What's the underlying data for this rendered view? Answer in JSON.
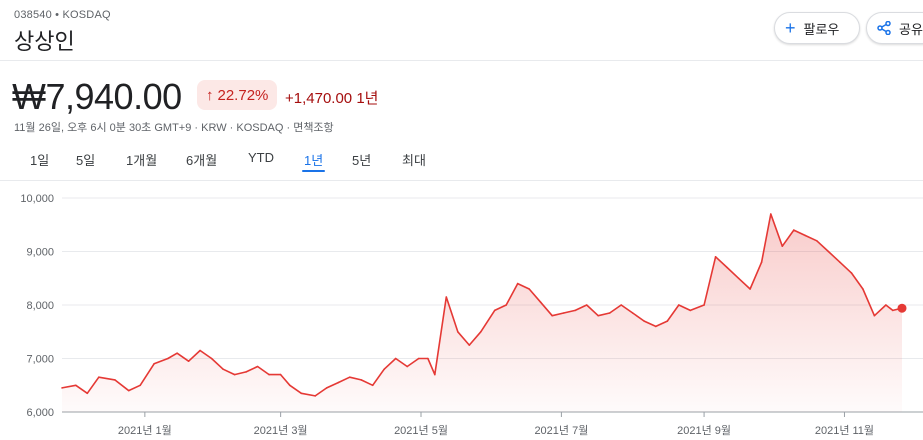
{
  "header": {
    "ticker": "038540 • KOSDAQ",
    "name": "상상인",
    "follow_label": "팔로우",
    "share_label": "공유"
  },
  "quote": {
    "price": "₩7,940.00",
    "pct_change": "22.72%",
    "abs_change": "+1,470.00 1년",
    "meta": "11월 26일, 오후 6시 0분 30초 GMT+9 · KRW · KOSDAQ · 면책조항"
  },
  "tabs": [
    "1일",
    "5일",
    "1개월",
    "6개월",
    "YTD",
    "1년",
    "5년",
    "최대"
  ],
  "active_tab": "1년",
  "colors": {
    "line": "#e53935",
    "up_badge_bg": "#fce8e6",
    "accent": "#1a73e8"
  },
  "icons": {
    "follow": "plus-icon",
    "share": "share-icon",
    "pct": "arrow-up-icon"
  },
  "chart_data": {
    "type": "area",
    "ylim": [
      6000,
      10000
    ],
    "yticks": [
      6000,
      7000,
      8000,
      9000,
      10000
    ],
    "ytick_labels": [
      "6,000",
      "7,000",
      "8,000",
      "9,000",
      "10,000"
    ],
    "xticks": [
      "2021-01-01",
      "2021-03-01",
      "2021-05-01",
      "2021-07-01",
      "2021-09-01",
      "2021-11-01"
    ],
    "xtick_labels": [
      "2021년 1월",
      "2021년 3월",
      "2021년 5월",
      "2021년 7월",
      "2021년 9월",
      "2021년 11월"
    ],
    "x_range": [
      "2020-11-26",
      "2021-11-26"
    ],
    "series": [
      {
        "x": [
          "2020-11-26",
          "2020-12-02",
          "2020-12-07",
          "2020-12-12",
          "2020-12-19",
          "2020-12-25",
          "2020-12-30",
          "2021-01-05",
          "2021-01-11",
          "2021-01-15",
          "2021-01-20",
          "2021-01-25",
          "2021-01-30",
          "2021-02-04",
          "2021-02-09",
          "2021-02-14",
          "2021-02-19",
          "2021-02-24",
          "2021-03-01",
          "2021-03-05",
          "2021-03-10",
          "2021-03-16",
          "2021-03-21",
          "2021-03-26",
          "2021-03-31",
          "2021-04-05",
          "2021-04-10",
          "2021-04-15",
          "2021-04-20",
          "2021-04-25",
          "2021-04-30",
          "2021-05-04",
          "2021-05-07",
          "2021-05-12",
          "2021-05-17",
          "2021-05-22",
          "2021-05-27",
          "2021-06-02",
          "2021-06-07",
          "2021-06-12",
          "2021-06-17",
          "2021-06-22",
          "2021-06-27",
          "2021-07-02",
          "2021-07-07",
          "2021-07-12",
          "2021-07-17",
          "2021-07-22",
          "2021-07-27",
          "2021-08-01",
          "2021-08-06",
          "2021-08-11",
          "2021-08-16",
          "2021-08-21",
          "2021-08-26",
          "2021-09-01",
          "2021-09-06",
          "2021-09-11",
          "2021-09-16",
          "2021-09-21",
          "2021-09-26",
          "2021-09-30",
          "2021-10-05",
          "2021-10-10",
          "2021-10-15",
          "2021-10-20",
          "2021-10-25",
          "2021-10-30",
          "2021-11-04",
          "2021-11-09",
          "2021-11-14",
          "2021-11-19",
          "2021-11-22",
          "2021-11-26"
        ],
        "y": [
          6450,
          6500,
          6350,
          6650,
          6600,
          6400,
          6500,
          6900,
          7000,
          7100,
          6950,
          7150,
          7000,
          6800,
          6700,
          6750,
          6850,
          6700,
          6700,
          6500,
          6350,
          6300,
          6450,
          6550,
          6650,
          6600,
          6500,
          6800,
          7000,
          6850,
          7000,
          7000,
          6700,
          8150,
          7500,
          7250,
          7500,
          7900,
          8000,
          8400,
          8300,
          8050,
          7800,
          7850,
          7900,
          8000,
          7800,
          7850,
          8000,
          7850,
          7700,
          7600,
          7700,
          8000,
          7900,
          8000,
          8900,
          8700,
          8500,
          8300,
          8800,
          9700,
          9100,
          9400,
          9300,
          9200,
          9000,
          8800,
          8600,
          8300,
          7800,
          8000,
          7900,
          7940
        ]
      }
    ]
  }
}
